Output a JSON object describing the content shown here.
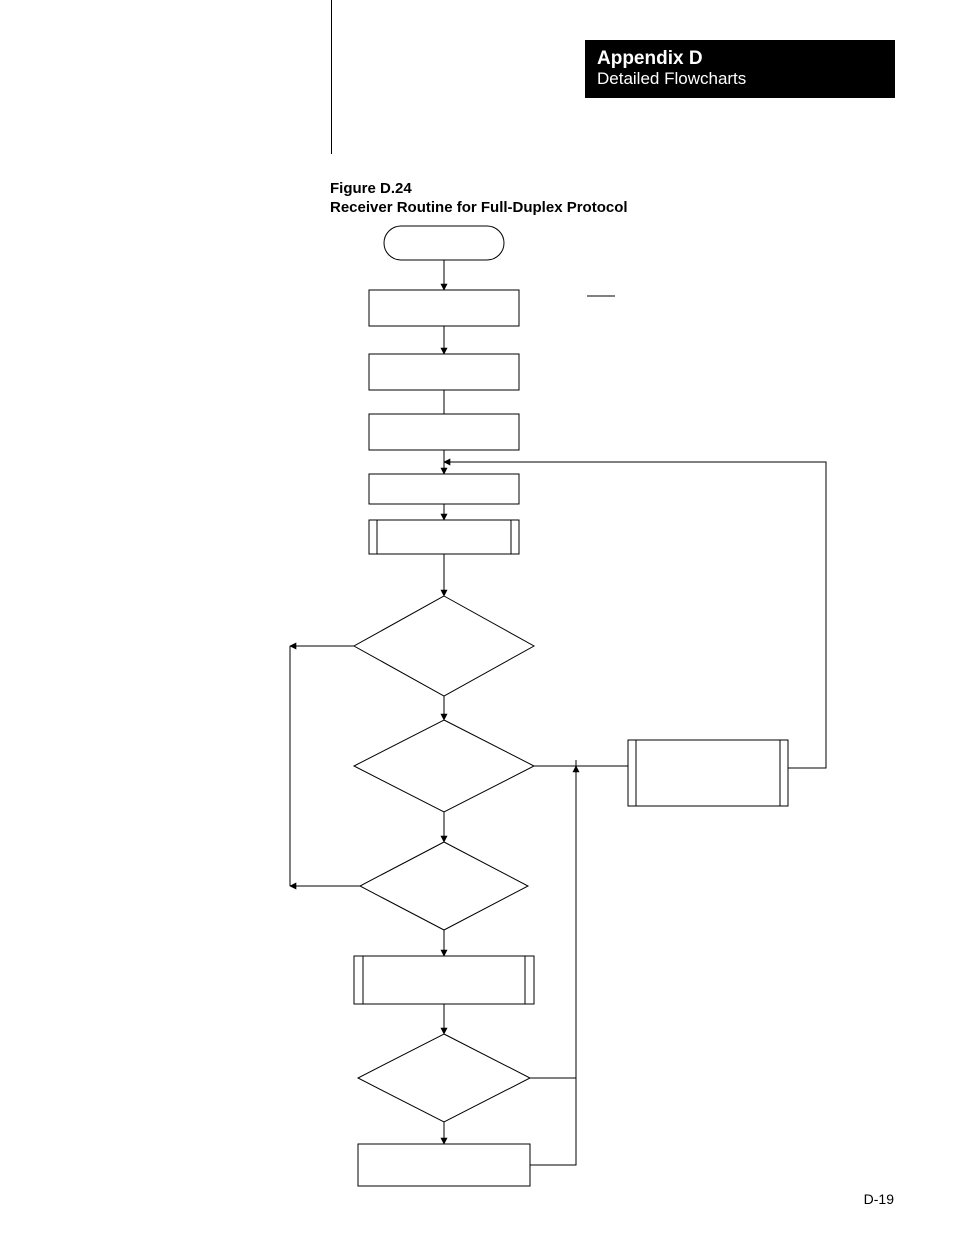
{
  "header": {
    "appendix": "Appendix D",
    "section": "Detailed Flowcharts"
  },
  "figure": {
    "number": "Figure D.24",
    "title": "Receiver Routine for Full-Duplex Protocol"
  },
  "page_number": "D-19",
  "chart_data": {
    "type": "diagram",
    "subtype": "flowchart",
    "title": "Receiver Routine for Full-Duplex Protocol",
    "nodes": [
      {
        "id": "start",
        "shape": "terminator",
        "label": ""
      },
      {
        "id": "p1",
        "shape": "process",
        "label": ""
      },
      {
        "id": "p2",
        "shape": "process",
        "label": ""
      },
      {
        "id": "p3",
        "shape": "process",
        "label": ""
      },
      {
        "id": "p4",
        "shape": "process",
        "label": ""
      },
      {
        "id": "sub1",
        "shape": "subroutine",
        "label": ""
      },
      {
        "id": "d1",
        "shape": "decision",
        "label": ""
      },
      {
        "id": "d2",
        "shape": "decision",
        "label": ""
      },
      {
        "id": "sideSub",
        "shape": "subroutine",
        "label": ""
      },
      {
        "id": "d3",
        "shape": "decision",
        "label": ""
      },
      {
        "id": "sub2",
        "shape": "subroutine",
        "label": ""
      },
      {
        "id": "d4",
        "shape": "decision",
        "label": ""
      },
      {
        "id": "p5",
        "shape": "process",
        "label": ""
      }
    ],
    "edges": [
      {
        "from": "start",
        "to": "p1"
      },
      {
        "from": "p1",
        "to": "p2"
      },
      {
        "from": "p2",
        "to": "p3"
      },
      {
        "from": "p3",
        "to": "p4"
      },
      {
        "from": "p4",
        "to": "sub1"
      },
      {
        "from": "sub1",
        "to": "d1"
      },
      {
        "from": "d1",
        "to": "d2",
        "path": "down"
      },
      {
        "from": "d1",
        "to": "leftBus",
        "path": "left"
      },
      {
        "from": "d2",
        "to": "d3",
        "path": "down"
      },
      {
        "from": "d2",
        "to": "sideSub",
        "path": "right"
      },
      {
        "from": "sideSub",
        "to": "p4",
        "path": "loop-right-up"
      },
      {
        "from": "d3",
        "to": "sub2",
        "path": "down"
      },
      {
        "from": "d3",
        "to": "leftBus",
        "path": "left"
      },
      {
        "from": "sub2",
        "to": "d4"
      },
      {
        "from": "d4",
        "to": "p5",
        "path": "down"
      },
      {
        "from": "d4",
        "to": "sideSub",
        "path": "right-up-to-d2-right-entry"
      },
      {
        "from": "p5",
        "to": "sideSub",
        "path": "right-up-to-d2-right-entry"
      }
    ]
  }
}
